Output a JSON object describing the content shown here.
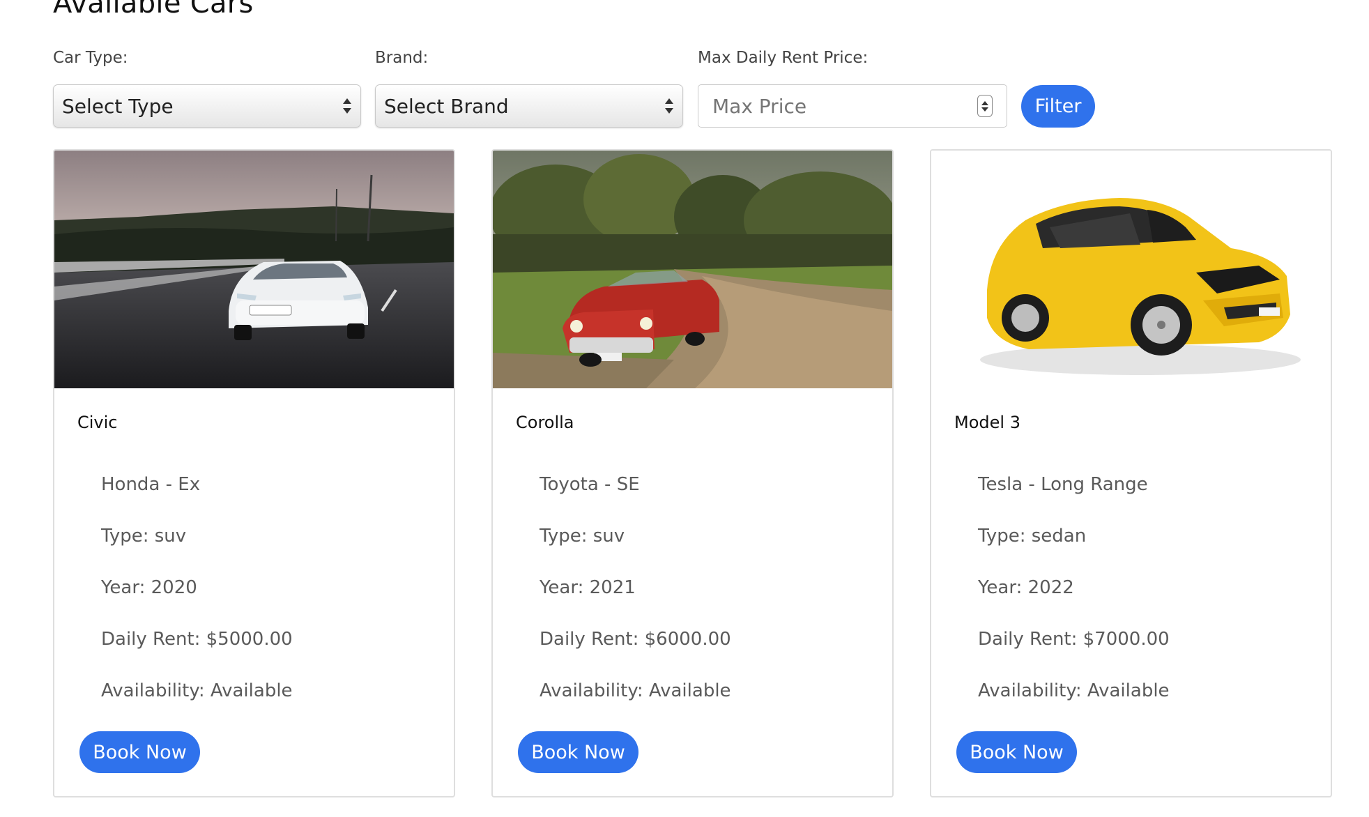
{
  "page": {
    "title": "Available Cars"
  },
  "filters": {
    "car_type_label": "Car Type:",
    "car_type_selected": "Select Type",
    "brand_label": "Brand:",
    "brand_selected": "Select Brand",
    "max_price_label": "Max Daily Rent Price:",
    "max_price_placeholder": "Max Price",
    "max_price_value": "",
    "filter_button": "Filter"
  },
  "colors": {
    "primary": "#2f72ec",
    "card_border": "#dedede",
    "text_muted": "#5a5a5a"
  },
  "cars": [
    {
      "model": "Civic",
      "brand_line": "Honda - Ex",
      "type_line": "Type: suv",
      "year_line": "Year: 2020",
      "rent_line": "Daily Rent: $5000.00",
      "availability_line": "Availability: Available",
      "button": "Book Now",
      "image": "white-sedan-on-road-photo"
    },
    {
      "model": "Corolla",
      "brand_line": "Toyota - SE",
      "type_line": "Type: suv",
      "year_line": "Year: 2021",
      "rent_line": "Daily Rent: $6000.00",
      "availability_line": "Availability: Available",
      "button": "Book Now",
      "image": "red-vintage-convertible-photo"
    },
    {
      "model": "Model 3",
      "brand_line": "Tesla - Long Range",
      "type_line": "Type: sedan",
      "year_line": "Year: 2022",
      "rent_line": "Daily Rent: $7000.00",
      "availability_line": "Availability: Available",
      "button": "Book Now",
      "image": "yellow-hatchback-photo"
    }
  ]
}
